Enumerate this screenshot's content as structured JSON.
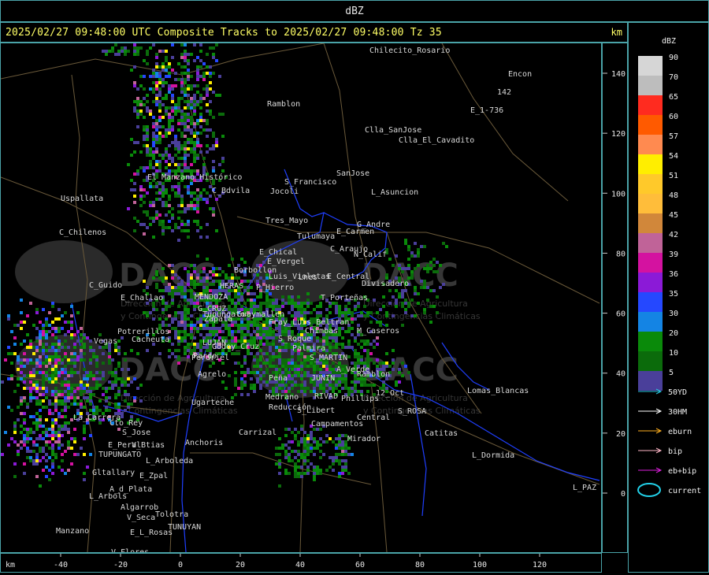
{
  "window": {
    "title": "dBZ"
  },
  "header": {
    "text": "2025/02/27 09:48:00 UTC Composite Tracks to 2025/02/27 09:48:00 Tz 35",
    "unit": "km"
  },
  "axes": {
    "x_unit": "km",
    "x_ticks": [
      "-40",
      "-20",
      "0",
      "20",
      "40",
      "60",
      "80",
      "100",
      "120"
    ],
    "y_ticks": [
      "140",
      "120",
      "100",
      "80",
      "60",
      "40",
      "20",
      "0"
    ]
  },
  "legend": {
    "title": "dBZ",
    "levels": [
      {
        "label": "90",
        "color": "#d6d6d6"
      },
      {
        "label": "70",
        "color": "#bdbdbd"
      },
      {
        "label": "65",
        "color": "#ff2b1f"
      },
      {
        "label": "60",
        "color": "#ff5a00"
      },
      {
        "label": "57",
        "color": "#ff8a50"
      },
      {
        "label": "54",
        "color": "#ffee00"
      },
      {
        "label": "51",
        "color": "#ffc92a"
      },
      {
        "label": "48",
        "color": "#ffbd3a"
      },
      {
        "label": "45",
        "color": "#d1873a"
      },
      {
        "label": "42",
        "color": "#c06398"
      },
      {
        "label": "39",
        "color": "#d412a0"
      },
      {
        "label": "36",
        "color": "#8b1ad7"
      },
      {
        "label": "35",
        "color": "#2548ff"
      },
      {
        "label": "30",
        "color": "#1484e4"
      },
      {
        "label": "20",
        "color": "#0a8a0a"
      },
      {
        "label": "10",
        "color": "#0b6b0b"
      },
      {
        "label": "5",
        "color": "#4a3f9a"
      }
    ],
    "tracks": [
      {
        "label": "50YD",
        "color": "#29c8e0"
      },
      {
        "label": "30HM",
        "color": "#ffffff"
      },
      {
        "label": "eburn",
        "color": "#ffb020"
      },
      {
        "label": "bip",
        "color": "#ffb8c8"
      },
      {
        "label": "eb+bip",
        "color": "#e020e0"
      }
    ],
    "current": {
      "label": "current",
      "color": "#22d0e8"
    }
  },
  "map": {
    "watermark": {
      "brand": "DACC",
      "subtitle1": "Dirección de Agricultura",
      "subtitle2": "y Contingencias Climáticas"
    },
    "places": [
      "Chilecito_Rosario",
      "Encon",
      "142",
      "E_1-736",
      "Ramblon",
      "Clla_SanJose",
      "Clla_El_Cavadito",
      "El_Manzano_Histórico",
      "Uspallata",
      "S_Francisco",
      "Jocoli",
      "C_Bdvila",
      "SanJose",
      "L_Asuncion",
      "Tres_Mayo",
      "G_Andre",
      "Tulumaya",
      "E_Carmen",
      "C_Chilenos",
      "E_Chical",
      "C_Araujo",
      "N_Calif",
      "E_Vergel",
      "Borbollon",
      "C_Guido",
      "E_Central",
      "Divisadero",
      "Luis_Violetas",
      "P_Hierro",
      "Lnes",
      "MENDOZA",
      "HERAS",
      "E_Challao",
      "T_Porteñas",
      "Tupungato",
      "G_CRUZ",
      "Guaymallen",
      "Fray_Luis_Beltran",
      "Zapata",
      "Potrerillos",
      "Cacheuta",
      "Vegas",
      "LUJAN",
      "Godoy_Cruz",
      "Chimbas",
      "Pardo",
      "M_Caseros",
      "S_Roque",
      "Palmira",
      "Perdriel",
      "S_MARTIN",
      "Agrelo",
      "A_Verde",
      "Ramblon",
      "Peña",
      "JUNIN",
      "Lomas_Blancas",
      "Ugarteche",
      "Medrano",
      "RIVAD",
      "12_Oct",
      "Phillips",
      "Reducción",
      "La_Carrera",
      "S_Libert",
      "S_ROSA",
      "Campamentos",
      "Central",
      "Cto_Rey",
      "S_Jose",
      "Catitas",
      "Anchoris",
      "E_Peral",
      "V_Btias",
      "Carrizal",
      "Mirador",
      "TUPUNGATO",
      "L_Arboleda",
      "L_Dormida",
      "Gltallary",
      "E_Zpal",
      "A_d_Plata",
      "L_Arbols",
      "Algarrob",
      "V_Seca",
      "Tolotra",
      "L_PAZ",
      "Manzano",
      "E_L_Rosas",
      "TUNUYAN",
      "V_Flores"
    ]
  }
}
